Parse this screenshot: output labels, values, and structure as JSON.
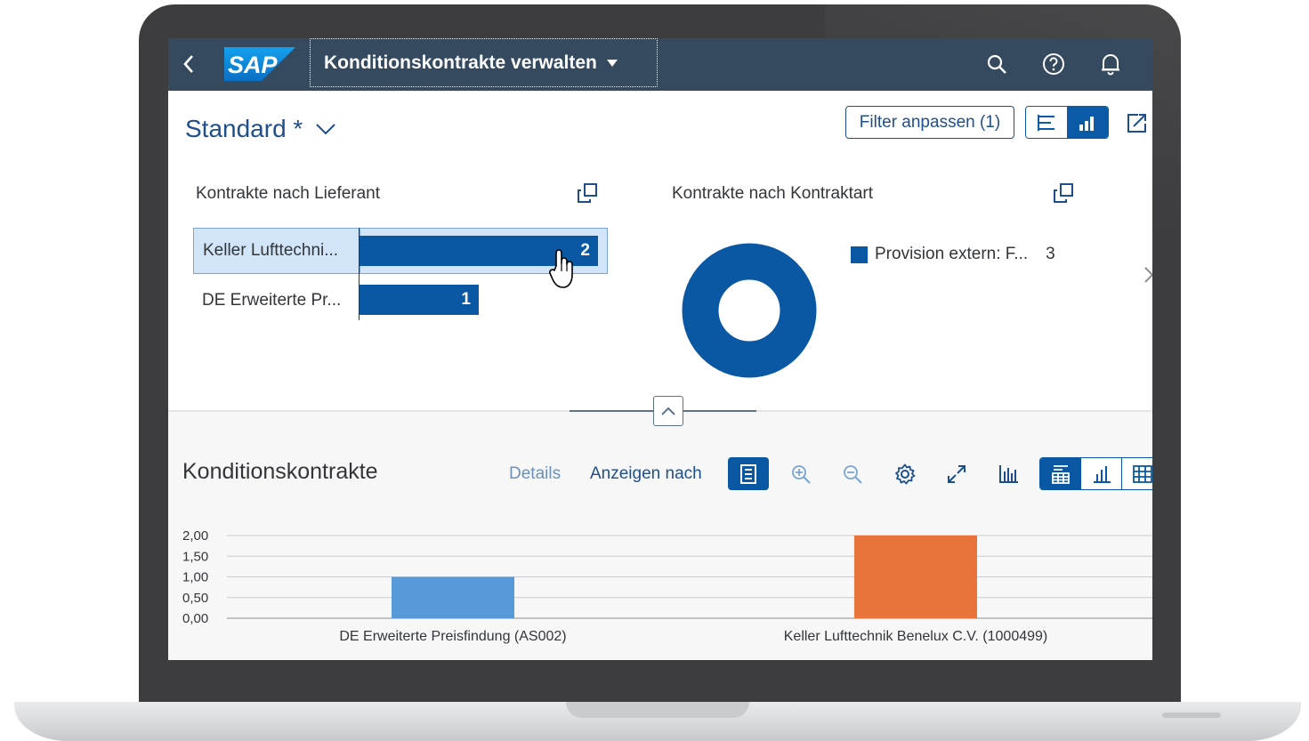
{
  "shell": {
    "app_title": "Konditionskontrakte verwalten",
    "logo_text": "SAP"
  },
  "header": {
    "variant": "Standard *",
    "filter_button": "Filter anpassen (1)"
  },
  "card_supplier": {
    "title": "Kontrakte nach Lieferant",
    "rows": [
      {
        "label": "Keller Lufttechni...",
        "value": 2,
        "value_label": "2",
        "selected": true
      },
      {
        "label": "DE Erweiterte Pr...",
        "value": 1,
        "value_label": "1",
        "selected": false
      }
    ]
  },
  "card_type": {
    "title": "Kontrakte nach Kontraktart",
    "legend_label": "Provision extern: F...",
    "legend_value": "3",
    "donut_value": 3
  },
  "table_section": {
    "title": "Konditionskontrakte",
    "details_label": "Details",
    "display_by_label": "Anzeigen nach"
  },
  "colors": {
    "shell": "#354a5f",
    "brand_blue": "#0a58a4",
    "bar_light_blue": "#5899da",
    "bar_orange": "#e8743b"
  },
  "chart_data": {
    "type": "bar",
    "categories": [
      "DE Erweiterte Preisfindung (AS002)",
      "Keller Lufttechnik Benelux C.V. (1000499)"
    ],
    "values": [
      1,
      2
    ],
    "colors": [
      "#5899da",
      "#e8743b"
    ],
    "ylim": [
      0,
      2
    ],
    "yticks": [
      "2,00",
      "1,50",
      "1,00",
      "0,50",
      "0,00"
    ],
    "ytick_values": [
      2,
      1.5,
      1,
      0.5,
      0
    ],
    "grid": true
  }
}
